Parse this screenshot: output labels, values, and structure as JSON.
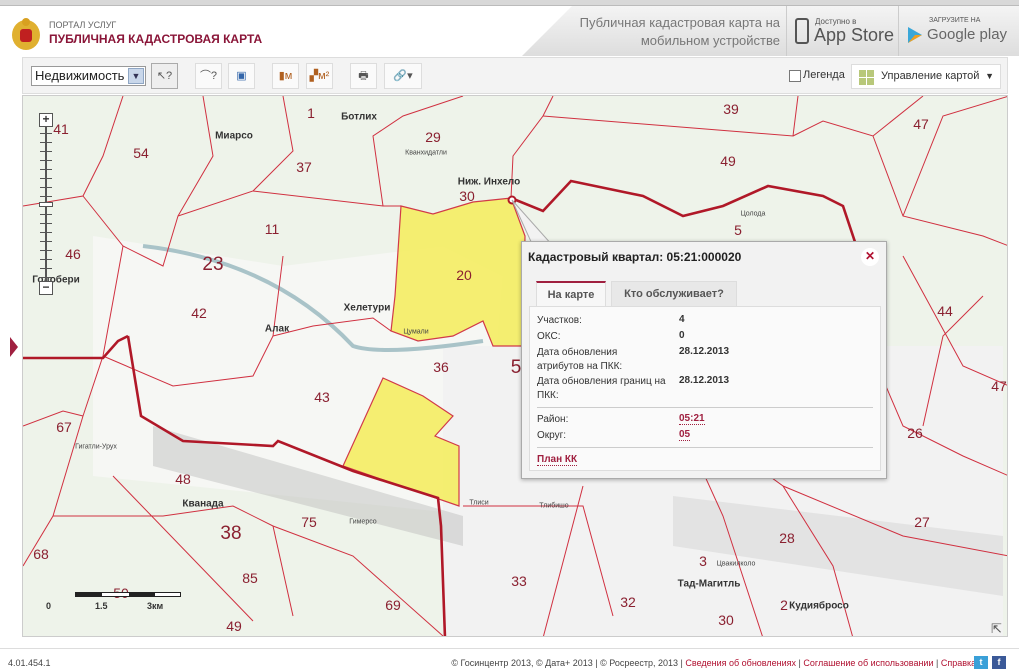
{
  "header": {
    "portal": "ПОРТАЛ УСЛУГ",
    "title": "ПУБЛИЧНАЯ КАДАСТРОВАЯ КАРТА",
    "promo": "Публичная кадастровая карта на мобильном устройстве",
    "appstore_small": "Доступно в",
    "appstore": "App Store",
    "gplay_small": "ЗАГРУЗИТЕ НА",
    "gplay": "Google play"
  },
  "toolbar": {
    "layer_select": "Недвижимость",
    "legend_label": "Легенда",
    "legend_checked": false,
    "map_control": "Управление картой",
    "tools": [
      "select-info",
      "measure-distance-info",
      "area-info",
      "measure-length",
      "measure-area",
      "print",
      "link"
    ]
  },
  "map": {
    "labels": [
      "41",
      "54",
      "Миарсо",
      "37",
      "Ботлих",
      "1",
      "29",
      "Кванхидатли",
      "Ниж. Инхело",
      "30",
      "49",
      "39",
      "47",
      "11",
      "23",
      "46",
      "Годобери",
      "20",
      "42",
      "Алак",
      "Хелетури",
      "Цумали",
      "36",
      "43",
      "44",
      "47",
      "26",
      "67",
      "Гигатли-Урух",
      "48",
      "Кванада",
      "38",
      "75",
      "Гимерсо",
      "85",
      "68",
      "50",
      "69",
      "49",
      "28",
      "27",
      "33",
      "3",
      "Цвакилколо",
      "Тад-Магитль",
      "32",
      "2",
      "Кудиябросо",
      "30",
      "Тлибишо",
      "Тлиси",
      "Цолода",
      "5",
      "5"
    ],
    "scale": [
      "0",
      "1.5",
      "3км"
    ],
    "colors": {
      "boundary": "#d03040",
      "highlight": "#f5ee6a",
      "background": "#eef3ea"
    }
  },
  "popup": {
    "title": "Кадастровый квартал: 05:21:000020",
    "tabs": [
      "На карте",
      "Кто обслуживает?"
    ],
    "rows": [
      {
        "label": "Участков:",
        "value": "4"
      },
      {
        "label": "ОКС:",
        "value": "0"
      },
      {
        "label": "Дата обновления атрибутов на ПКК:",
        "value": "28.12.2013"
      },
      {
        "label": "Дата обновления границ на ПКК:",
        "value": "28.12.2013"
      }
    ],
    "district_label": "Район:",
    "district": "05:21",
    "okrug_label": "Округ:",
    "okrug": "05",
    "plan": "План КК"
  },
  "footer": {
    "version": "4.01.454.1",
    "copyright": "© Госинцентр 2013, © Дата+ 2013 | © Росреестр, 2013 | ",
    "links": [
      "Сведения об обновлениях",
      "Соглашение об использовании",
      "Справка"
    ]
  }
}
